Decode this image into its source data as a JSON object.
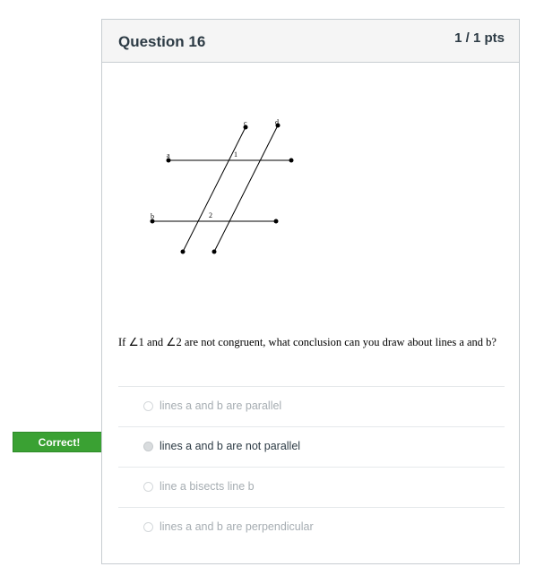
{
  "question": {
    "title": "Question 16",
    "points": "1 / 1 pts",
    "text_prefix": "If ",
    "angle1": "∠1",
    "text_and": " and ",
    "angle2": "∠2",
    "text_suffix": " are not congruent, what conclusion can you draw about lines a and b?"
  },
  "figure": {
    "label_a": "a",
    "label_b": "b",
    "label_c": "c",
    "label_d": "d",
    "label_1": "1",
    "label_2": "2"
  },
  "correct_flag": "Correct!",
  "answers": [
    {
      "label": "lines a and b are parallel",
      "selected": false
    },
    {
      "label": "lines a and b are not parallel",
      "selected": true
    },
    {
      "label": "line a bisects line b",
      "selected": false
    },
    {
      "label": "lines a and b are perpendicular",
      "selected": false
    }
  ]
}
